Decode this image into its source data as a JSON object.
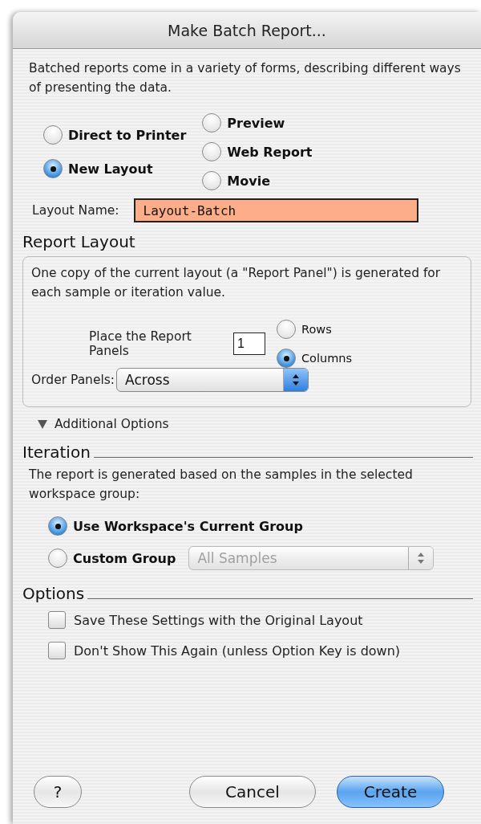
{
  "window": {
    "title": "Make Batch Report..."
  },
  "intro": "Batched reports come in a variety of forms, describing different ways of presenting the data.",
  "output_types": [
    {
      "label": "Direct to Printer",
      "selected": false
    },
    {
      "label": "New Layout",
      "selected": true
    },
    {
      "label": "Preview",
      "selected": false
    },
    {
      "label": "Web Report",
      "selected": false
    },
    {
      "label": "Movie",
      "selected": false
    }
  ],
  "layout_name": {
    "label": "Layout Name:",
    "value": "Layout-Batch"
  },
  "report_layout": {
    "heading": "Report Layout",
    "description": "One copy of the current layout (a \"Report Panel\") is generated for each sample or iteration value.",
    "place_label": "Place the Report Panels",
    "count": "1",
    "arrangement": [
      {
        "label": "Rows",
        "selected": false
      },
      {
        "label": "Columns",
        "selected": true
      }
    ],
    "order_label": "Order Panels:",
    "order_value": "Across"
  },
  "additional_options": {
    "label": "Additional Options",
    "expanded": true
  },
  "iteration": {
    "heading": "Iteration",
    "description": "The report is generated based on the samples in the selected workspace group:",
    "choices": [
      {
        "label": "Use Workspace's Current Group",
        "selected": true
      },
      {
        "label": "Custom Group",
        "selected": false
      }
    ],
    "group_popup": {
      "value": "All Samples",
      "disabled": true
    }
  },
  "options": {
    "heading": "Options",
    "items": [
      {
        "label": "Save These Settings with the Original Layout",
        "checked": false
      },
      {
        "label": "Don't Show This Again (unless Option Key is down)",
        "checked": false
      }
    ]
  },
  "buttons": [
    {
      "kind": "help",
      "label": "?"
    },
    {
      "kind": "cancel",
      "label": "Cancel"
    },
    {
      "kind": "default",
      "label": "Create"
    }
  ]
}
